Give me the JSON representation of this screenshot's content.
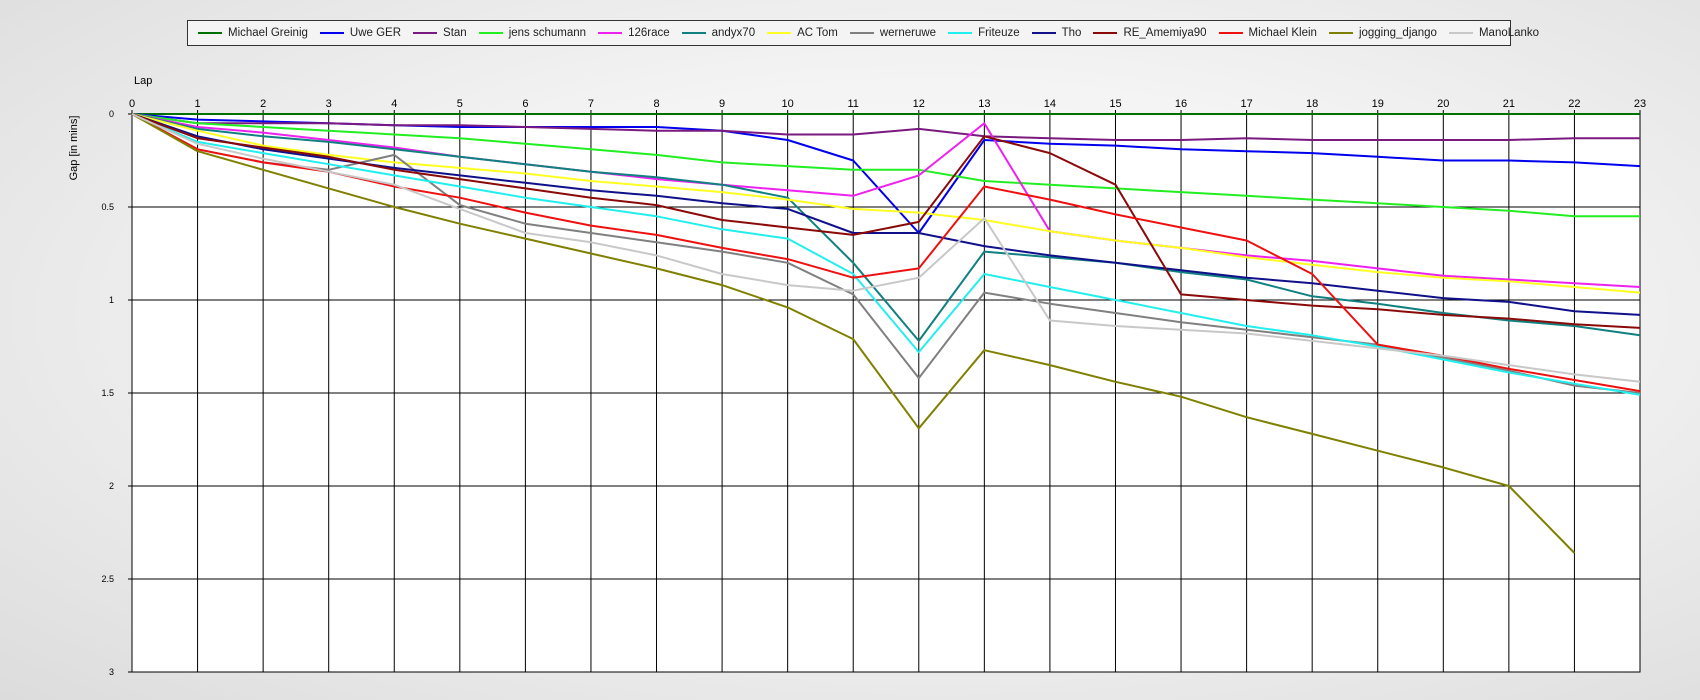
{
  "chart_data": {
    "type": "line",
    "xlabel": "Lap",
    "ylabel": "Gap [in mins]",
    "xlim": [
      0,
      23
    ],
    "ylim": [
      0,
      3
    ],
    "y_inverted": true,
    "grid": true,
    "legend_position": "top",
    "x_ticks": [
      0,
      1,
      2,
      3,
      4,
      5,
      6,
      7,
      8,
      9,
      10,
      11,
      12,
      13,
      14,
      15,
      16,
      17,
      18,
      19,
      20,
      21,
      22,
      23
    ],
    "y_ticks": [
      0,
      0.5,
      1,
      1.5,
      2,
      2.5,
      3
    ],
    "y_tick_labels": [
      "0",
      "0.5",
      "1",
      "1.5",
      "2",
      "2.5",
      "3"
    ],
    "series": [
      {
        "name": "Michael Greinig",
        "color": "#007000",
        "x": [
          0,
          1,
          2,
          3,
          4,
          5,
          6,
          7,
          8,
          9,
          10,
          11,
          12,
          13,
          14,
          15,
          16,
          17,
          18,
          19,
          20,
          21,
          22,
          23
        ],
        "y": [
          0,
          0,
          0,
          0,
          0,
          0,
          0,
          0,
          0,
          0,
          0,
          0,
          0,
          0,
          0,
          0,
          0,
          0,
          0,
          0,
          0,
          0,
          0,
          0
        ]
      },
      {
        "name": "Uwe GER",
        "color": "#0000ee",
        "x": [
          0,
          1,
          2,
          3,
          4,
          5,
          6,
          7,
          8,
          9,
          10,
          11,
          12,
          13,
          14,
          15,
          16,
          17,
          18,
          19,
          20,
          21,
          22,
          23
        ],
        "y": [
          0,
          0.03,
          0.04,
          0.05,
          0.06,
          0.07,
          0.07,
          0.07,
          0.07,
          0.09,
          0.14,
          0.25,
          0.64,
          0.14,
          0.16,
          0.17,
          0.19,
          0.2,
          0.21,
          0.23,
          0.25,
          0.25,
          0.26,
          0.28
        ]
      },
      {
        "name": "Stan",
        "color": "#7a1a80",
        "x": [
          0,
          1,
          2,
          3,
          4,
          5,
          6,
          7,
          8,
          9,
          10,
          11,
          12,
          13,
          14,
          15,
          16,
          17,
          18,
          19,
          20,
          21,
          22,
          23
        ],
        "y": [
          0,
          0.05,
          0.05,
          0.05,
          0.06,
          0.06,
          0.07,
          0.08,
          0.09,
          0.09,
          0.11,
          0.11,
          0.08,
          0.12,
          0.13,
          0.14,
          0.14,
          0.13,
          0.14,
          0.14,
          0.14,
          0.14,
          0.13,
          0.13
        ]
      },
      {
        "name": "jens  schumann",
        "color": "#22ee22",
        "x": [
          0,
          1,
          2,
          3,
          4,
          5,
          6,
          7,
          8,
          9,
          10,
          11,
          12,
          13,
          14,
          15,
          16,
          17,
          18,
          19,
          20,
          21,
          22,
          23
        ],
        "y": [
          0,
          0.05,
          0.07,
          0.09,
          0.11,
          0.13,
          0.16,
          0.19,
          0.22,
          0.26,
          0.28,
          0.3,
          0.3,
          0.36,
          0.38,
          0.4,
          0.42,
          0.44,
          0.46,
          0.48,
          0.5,
          0.52,
          0.55,
          0.55
        ]
      },
      {
        "name": "126race",
        "color": "#ee22ee",
        "x": [
          0,
          1,
          2,
          3,
          4,
          5,
          6,
          7,
          8,
          9,
          10,
          11,
          12,
          13,
          14,
          15,
          16,
          17,
          18,
          19,
          20,
          21,
          22,
          23
        ],
        "y": [
          0,
          0.07,
          0.1,
          0.14,
          0.18,
          0.23,
          0.27,
          0.31,
          0.35,
          0.38,
          0.41,
          0.44,
          0.33,
          0.05,
          0.63,
          0.68,
          0.72,
          0.76,
          0.79,
          0.83,
          0.87,
          0.89,
          0.91,
          0.93
        ]
      },
      {
        "name": "andyx70",
        "color": "#118080",
        "x": [
          0,
          1,
          2,
          3,
          4,
          5,
          6,
          7,
          8,
          9,
          10,
          11,
          12,
          13,
          14,
          15,
          16,
          17,
          18,
          19,
          20,
          21,
          22,
          23
        ],
        "y": [
          0,
          0.08,
          0.12,
          0.15,
          0.19,
          0.23,
          0.27,
          0.31,
          0.34,
          0.38,
          0.45,
          0.8,
          1.22,
          0.74,
          0.77,
          0.8,
          0.85,
          0.89,
          0.98,
          1.02,
          1.07,
          1.11,
          1.14,
          1.19
        ]
      },
      {
        "name": "AC Tom",
        "color": "#ffff22",
        "x": [
          0,
          1,
          2,
          3,
          4,
          5,
          6,
          7,
          8,
          9,
          10,
          11,
          12,
          13,
          14,
          15,
          16,
          17,
          18,
          19,
          20,
          21,
          22,
          23
        ],
        "y": [
          0,
          0.09,
          0.17,
          0.22,
          0.26,
          0.29,
          0.32,
          0.36,
          0.39,
          0.42,
          0.46,
          0.51,
          0.53,
          0.57,
          0.63,
          0.68,
          0.72,
          0.77,
          0.81,
          0.85,
          0.88,
          0.9,
          0.93,
          0.96
        ]
      },
      {
        "name": "werneruwe",
        "color": "#808080",
        "x": [
          0,
          1,
          2,
          3,
          4,
          5,
          6,
          7,
          8,
          9,
          10,
          11,
          12,
          13,
          14,
          15,
          16,
          17,
          18,
          19,
          20,
          21,
          22,
          23
        ],
        "y": [
          0,
          0.19,
          0.26,
          0.3,
          0.22,
          0.49,
          0.59,
          0.64,
          0.69,
          0.74,
          0.8,
          0.97,
          1.42,
          0.96,
          1.02,
          1.07,
          1.12,
          1.16,
          1.2,
          1.24,
          1.31,
          1.38,
          1.46,
          1.5
        ]
      },
      {
        "name": "Friteuze",
        "color": "#22eeee",
        "x": [
          0,
          1,
          2,
          3,
          4,
          5,
          6,
          7,
          8,
          9,
          10,
          11,
          12,
          13,
          14,
          15,
          16,
          17,
          18,
          19,
          20,
          21,
          22,
          23
        ],
        "y": [
          0,
          0.15,
          0.21,
          0.27,
          0.33,
          0.39,
          0.45,
          0.5,
          0.55,
          0.62,
          0.67,
          0.86,
          1.28,
          0.86,
          0.93,
          1.0,
          1.07,
          1.14,
          1.19,
          1.25,
          1.32,
          1.39,
          1.45,
          1.51
        ]
      },
      {
        "name": "Tho",
        "color": "#10108a",
        "x": [
          0,
          1,
          2,
          3,
          4,
          5,
          6,
          7,
          8,
          9,
          10,
          11,
          12,
          13,
          14,
          15,
          16,
          17,
          18,
          19,
          20,
          21,
          22,
          23
        ],
        "y": [
          0,
          0.12,
          0.19,
          0.24,
          0.29,
          0.33,
          0.37,
          0.41,
          0.44,
          0.48,
          0.51,
          0.64,
          0.64,
          0.71,
          0.76,
          0.8,
          0.84,
          0.88,
          0.91,
          0.95,
          0.99,
          1.01,
          1.06,
          1.08
        ]
      },
      {
        "name": "RE_Amemiya90",
        "color": "#8a0a0a",
        "x": [
          0,
          1,
          2,
          3,
          4,
          5,
          6,
          7,
          8,
          9,
          10,
          11,
          12,
          13,
          14,
          15,
          16,
          17,
          18,
          19,
          20,
          21,
          22,
          23
        ],
        "y": [
          0,
          0.13,
          0.18,
          0.23,
          0.3,
          0.35,
          0.4,
          0.45,
          0.49,
          0.57,
          0.61,
          0.65,
          0.58,
          0.12,
          0.21,
          0.38,
          0.97,
          1.0,
          1.03,
          1.05,
          1.08,
          1.1,
          1.13,
          1.15
        ]
      },
      {
        "name": "Michael Klein",
        "color": "#ee1111",
        "x": [
          0,
          1,
          2,
          3,
          4,
          5,
          6,
          7,
          8,
          9,
          10,
          11,
          12,
          13,
          14,
          15,
          16,
          17,
          18,
          19,
          20,
          21,
          22,
          23
        ],
        "y": [
          0,
          0.19,
          0.26,
          0.31,
          0.39,
          0.45,
          0.53,
          0.6,
          0.65,
          0.72,
          0.78,
          0.88,
          0.83,
          0.39,
          0.46,
          0.54,
          0.61,
          0.68,
          0.86,
          1.24,
          1.3,
          1.37,
          1.43,
          1.49
        ]
      },
      {
        "name": "jogging_django",
        "color": "#808000",
        "x": [
          0,
          1,
          2,
          3,
          4,
          5,
          6,
          7,
          8,
          9,
          10,
          11,
          12,
          13,
          14,
          15,
          16,
          17,
          18,
          19,
          20,
          21,
          22
        ],
        "y": [
          0,
          0.2,
          0.3,
          0.4,
          0.5,
          0.59,
          0.67,
          0.75,
          0.83,
          0.92,
          1.04,
          1.21,
          1.69,
          1.27,
          1.35,
          1.44,
          1.52,
          1.63,
          1.72,
          1.81,
          1.9,
          2.0,
          2.36
        ]
      },
      {
        "name": "ManoLanko",
        "color": "#c8c8c8",
        "x": [
          0,
          1,
          2,
          3,
          4,
          5,
          6,
          7,
          8,
          9,
          10,
          11,
          12,
          13,
          14,
          15,
          16,
          17,
          18,
          19,
          20,
          21,
          22,
          23
        ],
        "y": [
          0,
          0.16,
          0.24,
          0.31,
          0.38,
          0.51,
          0.64,
          0.69,
          0.76,
          0.86,
          0.92,
          0.95,
          0.88,
          0.56,
          1.11,
          1.14,
          1.16,
          1.18,
          1.22,
          1.26,
          1.3,
          1.35,
          1.4,
          1.44
        ]
      }
    ]
  }
}
